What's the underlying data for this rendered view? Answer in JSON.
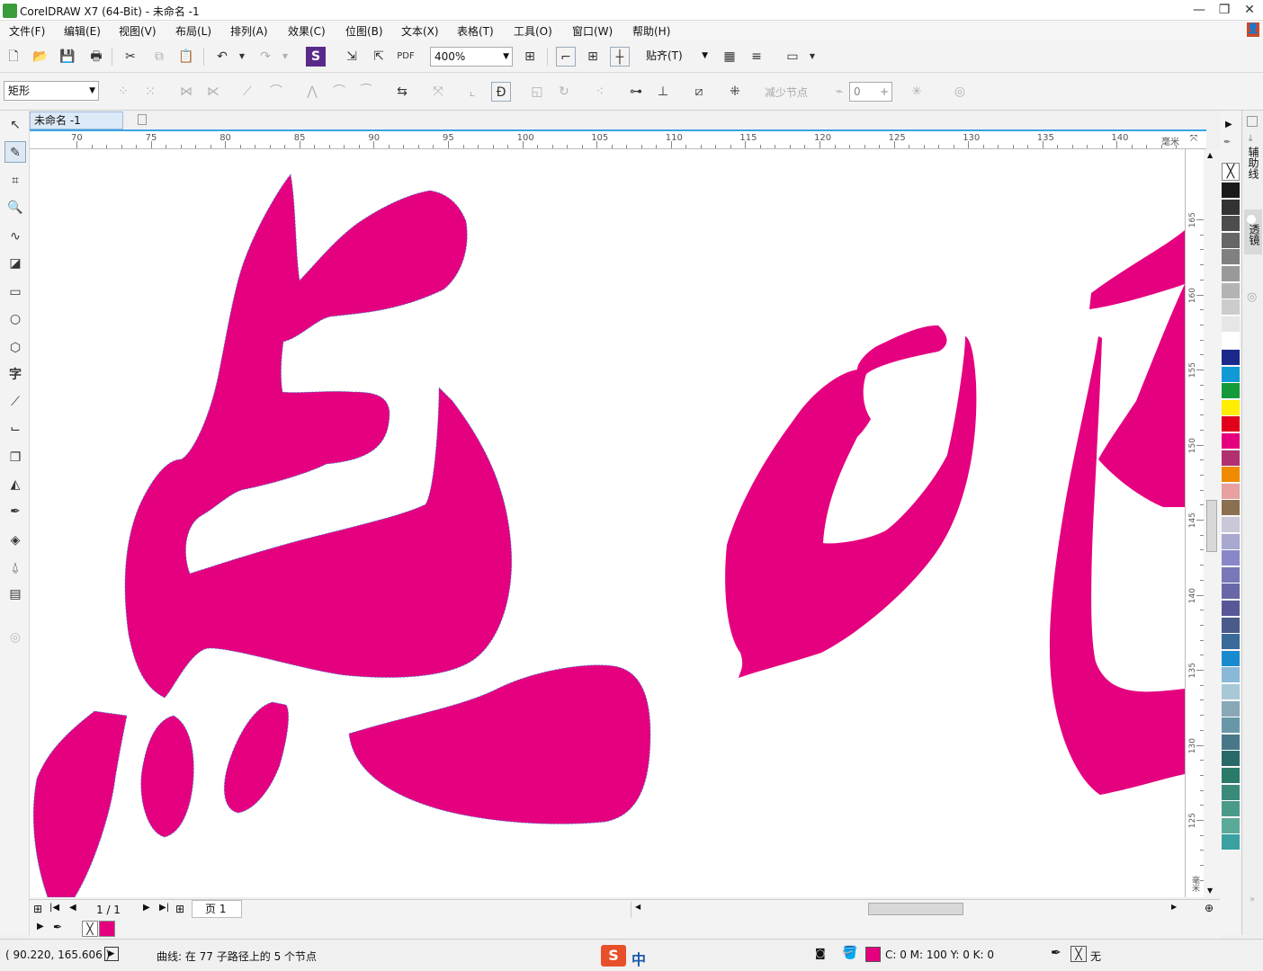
{
  "window": {
    "title": "CorelDRAW X7 (64-Bit) - 未命名 -1"
  },
  "menu": [
    "文件(F)",
    "编辑(E)",
    "视图(V)",
    "布局(L)",
    "排列(A)",
    "效果(C)",
    "位图(B)",
    "文本(X)",
    "表格(T)",
    "工具(O)",
    "窗口(W)",
    "帮助(H)"
  ],
  "toolbar": {
    "zoom": "400%",
    "snap_label": "贴齐(T)"
  },
  "propbar": {
    "shape_type": "矩形",
    "reduce_nodes": "减少节点",
    "smoothing": "0"
  },
  "document": {
    "tab_label": "未命名 -1"
  },
  "ruler": {
    "h_ticks": [
      "70",
      "75",
      "80",
      "85",
      "90",
      "95",
      "100",
      "105",
      "110",
      "115",
      "120",
      "125",
      "130",
      "135",
      "140"
    ],
    "h_unit": "毫米",
    "v_ticks": [
      "165",
      "160",
      "155",
      "150",
      "145",
      "140",
      "135",
      "130",
      "125"
    ],
    "v_unit": "毫米"
  },
  "dockers": {
    "guides": "辅助线",
    "lens": "透镜"
  },
  "pagenav": {
    "page_count": "1 / 1",
    "page_tab": "页 1"
  },
  "palette": [
    "#1a1a1a",
    "#333333",
    "#4d4d4d",
    "#666666",
    "#808080",
    "#999999",
    "#b3b3b3",
    "#cccccc",
    "#e6e6e6",
    "#ffffff",
    "#1b2a8a",
    "#0f9ad6",
    "#159a3a",
    "#ffed00",
    "#e3001b",
    "#e4007f",
    "#b03070",
    "#f08a00",
    "#e8a0a0",
    "#8a7050",
    "#c8c8d8",
    "#a8a8d0",
    "#8888c8",
    "#7878b8",
    "#6868a8",
    "#585898",
    "#4a5a8a",
    "#3a6a9a",
    "#1a8ad0",
    "#8ab8d8",
    "#a8c8d8",
    "#88a8b8",
    "#6898a8",
    "#487888",
    "#286868",
    "#2a7a6a",
    "#3a8a7a",
    "#4a9a8a",
    "#5aaa9a",
    "#3aa0a0"
  ],
  "fill_color": "#e4007f",
  "status": {
    "coords": "( 90.220, 165.606 )",
    "selection": "曲线: 在 77 子路径上的 5 个节点",
    "ime_label": "中",
    "fill_info": "C: 0 M: 100 Y: 0 K: 0",
    "outline_info": "无"
  }
}
